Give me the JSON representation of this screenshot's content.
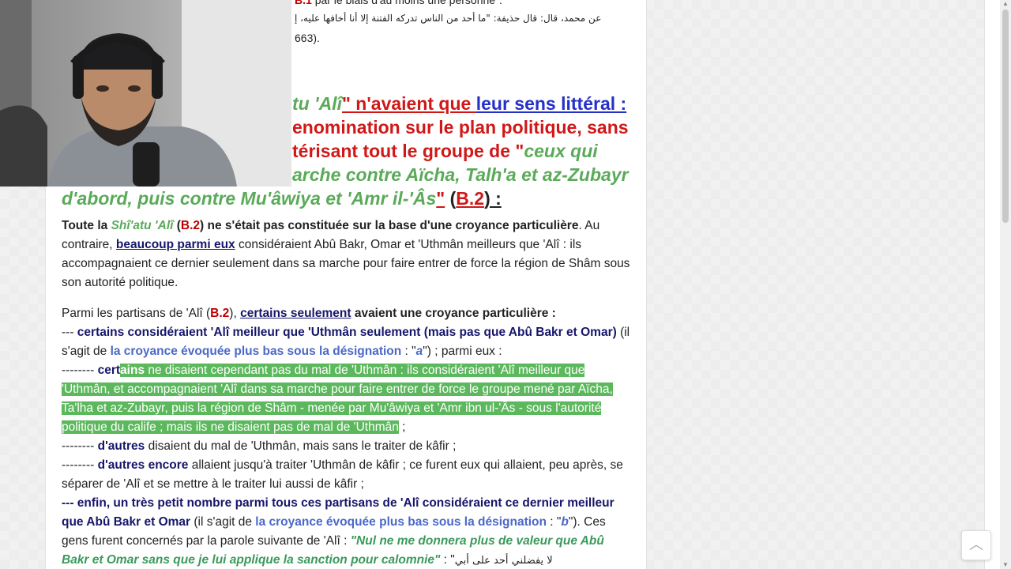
{
  "top": {
    "line1_ref": "B.1",
    "line1_text": "par le biais d'au moins une personne\".",
    "line2_arabic": "عن محمد، قال: قال حذيفة: \"ما أحد من الناس تدركه الفتنة إلا أنا أخافها عليه، إ",
    "line3_text": "663)."
  },
  "heading": {
    "part1": "tu 'Alî",
    "part2": "\" n'avaient que ",
    "part3": "leur sens littéral :",
    "line2": "enomination sur le plan politique, sans",
    "line3a": "térisant tout le groupe de \"",
    "line3b": "ceux qui",
    "line4": "arche contre Aïcha, Talh'a et az-Zubayr",
    "line5a": "d'abord, puis contre Mu'âwiya et 'Amr il-'Âs",
    "line5b": "\"",
    "line5c": " (",
    "line5ref": "B.2",
    "line5d": ") :"
  },
  "para1": {
    "t1": "Toute la ",
    "t2": "Shî'atu 'Alî",
    "t3": " (",
    "ref": "B.2",
    "t4": ") ne s'était pas constituée sur la base d'une croyance particulière",
    "t5": ". Au contraire, ",
    "t6": "beaucoup parmi eux",
    "t7": " considéraient Abû Bakr, Omar et 'Uthmân meilleurs que 'Alî : ils accompagnaient ce dernier seulement dans sa marche pour faire entrer de force la région de Shâm sous son autorité politique."
  },
  "para2": {
    "t1": "Parmi les partisans de 'Alî (",
    "ref": "B.2",
    "t2": "), ",
    "t3": "certains seulement",
    "t4": " avaient une croyance particulière :",
    "l1a": "--- ",
    "l1b": "certains considéraient 'Alî meilleur que 'Uthmân seulement (mais pas que Abû Bakr et Omar)",
    "l1c": " (il s'agit de ",
    "l1d": "la croyance évoquée plus bas sous la désignation",
    "l1e": " : \"",
    "l1f": "a",
    "l1g": "\") ; parmi eux :",
    "l2a": "-------- ",
    "l2b": "cert",
    "l2c": "ains",
    "l2d": " ne disaient cependant pas du mal de 'Uthmân : ils considéraient 'Alî meilleur que 'Uthmân, et accompagnaient 'Alî dans sa marche pour faire entrer de force le groupe mené par Aïcha, Ta'lha et az-Zubayr, puis la région de Shâm - menée par Mu'âwiya et 'Amr ibn ul-'Âs - sous l'autorité politique du calife ; mais ils ne disaient pas de mal de 'Uthmân",
    "l2e": " ;",
    "l3a": "-------- ",
    "l3b": "d'autres",
    "l3c": " disaient du mal de 'Uthmân, mais sans le traiter de kâfir ;",
    "l4a": "-------- ",
    "l4b": "d'autres encore",
    "l4c": " allaient jusqu'à traiter 'Uthmân de kâfir ; ce furent eux qui allaient, peu après, se séparer de 'Alî et se mettre à le traiter lui aussi de kâfir ;",
    "l5a": "--- ",
    "l5b": "enfin, un très petit nombre parmi tous ces partisans de 'Alî considéraient ce dernier meilleur que Abû Bakr et Omar",
    "l5c": " (il s'agit de ",
    "l5d": "la croyance évoquée plus bas sous la désignation",
    "l5e": " : \"",
    "l5f": "b",
    "l5g": "\"). Ces gens furent concernés par la parole suivante de 'Alî : ",
    "l5h": "\"Nul ne me donnera plus de valeur que Abû Bakr et Omar sans que je lui applique la sanction pour calomnie\"",
    "l5i": " : \"",
    "l5arabic": "لا يفضلني أحد على أبي"
  },
  "ui": {
    "back_to_top_icon": "chevron-up-icon",
    "selection_color": "#5cb85c"
  }
}
